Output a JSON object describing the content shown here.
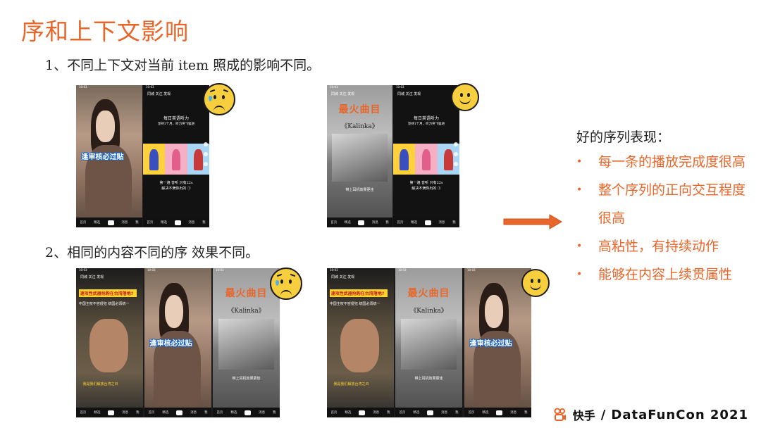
{
  "slide": {
    "title": "序和上下文影响",
    "point1": "1、不同上下文对当前 item 照成的影响不同。",
    "point2": "2、相同的内容不同的序 效果不同。"
  },
  "summary": {
    "title": "好的序列表现：",
    "bullets": [
      "每一条的播放完成度很高",
      "整个序列的正向交互程度很高",
      "高粘性，有持续动作",
      "能够在内容上续贯属性"
    ]
  },
  "screens": {
    "status_time": "10:03",
    "nav_labels": "同城  关注  发现",
    "bottom_nav": [
      "首页",
      "精选",
      "消息",
      "我"
    ],
    "woman_stamp": "逢审核必过贴",
    "english_title": "每日英语听力",
    "english_sub": "坚持1个月，听力突飞猛进",
    "english_desc_1": "第一遍 音听 只有22s",
    "english_desc_2": "解决不满你出的 ①",
    "kalinka_title": "最火曲目",
    "kalinka_sub": "《Kalinka》",
    "kalinka_caption": "带上耳机效果更佳",
    "news_banner": "速攻性武器抢购在台湾落地?",
    "news_sub": "中国主权不容侵犯  统国必须统一",
    "news_caption": "我是我们解放台湾之日"
  },
  "emojis": [
    "sad",
    "happy",
    "sad",
    "happy"
  ],
  "footer": {
    "brand": "快手",
    "separator": "/",
    "event": "DataFunCon 2021"
  },
  "colors": {
    "accent": "#e8662a",
    "emoji_yellow": "#f7ce3e",
    "tear_blue": "#4fb1e8"
  }
}
